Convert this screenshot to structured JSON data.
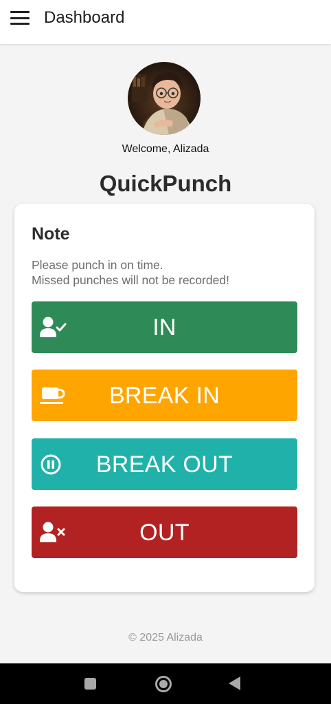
{
  "header": {
    "title": "Dashboard",
    "menu_icon": "hamburger-menu-icon"
  },
  "profile": {
    "avatar_icon": "user-avatar-photo",
    "welcome": "Welcome, Alizada"
  },
  "app": {
    "title": "QuickPunch"
  },
  "note": {
    "title": "Note",
    "line1": "Please punch in on time.",
    "line2": "Missed punches will not be recorded!"
  },
  "buttons": [
    {
      "label": "IN",
      "icon": "user-check-icon",
      "color": "#2e8b57"
    },
    {
      "label": "BREAK IN",
      "icon": "coffee-cup-icon",
      "color": "#ffa500"
    },
    {
      "label": "BREAK OUT",
      "icon": "pause-circle-icon",
      "color": "#20b2aa"
    },
    {
      "label": "OUT",
      "icon": "user-times-icon",
      "color": "#b22222"
    }
  ],
  "footer": {
    "copyright": "© 2025 Alizada"
  },
  "system_nav": {
    "recent_icon": "square-recent-apps-icon",
    "home_icon": "circle-home-icon",
    "back_icon": "triangle-back-icon"
  }
}
